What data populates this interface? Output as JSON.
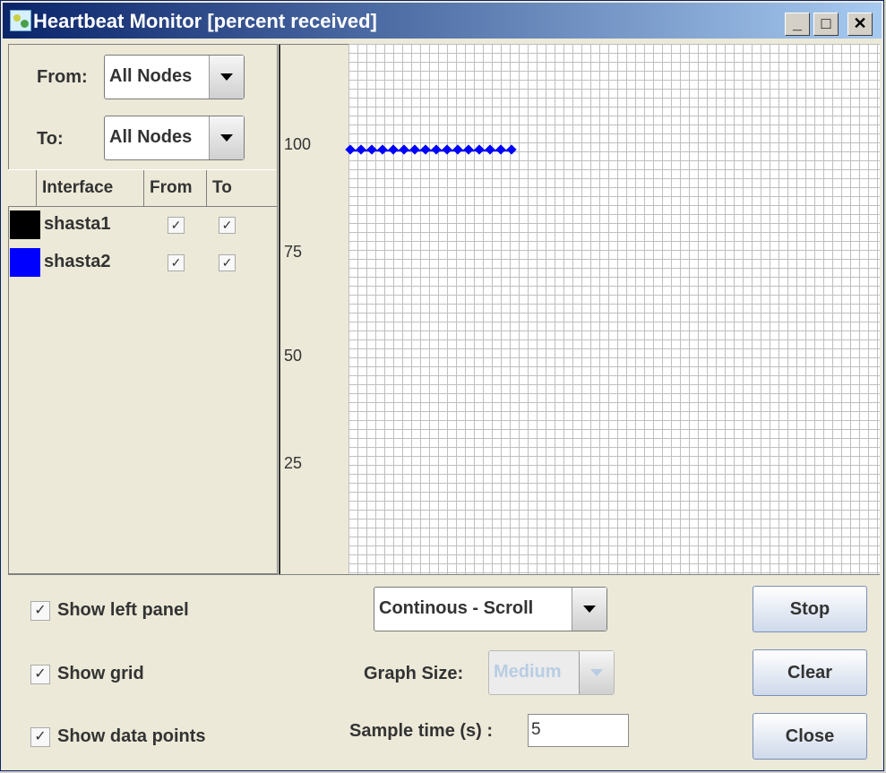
{
  "window": {
    "title": "Heartbeat Monitor [percent received]",
    "min_glyph": "_",
    "max_glyph": "□",
    "close_glyph": "✕"
  },
  "left_panel": {
    "from_label": "From:",
    "from_value": "All Nodes",
    "to_label": "To:",
    "to_value": "All Nodes",
    "table_headers": [
      "",
      "Interface",
      "From",
      "To"
    ],
    "rows": [
      {
        "color": "#000000",
        "name": "shasta1",
        "from": "✓",
        "to": "✓"
      },
      {
        "color": "#0000ff",
        "name": "shasta2",
        "from": "✓",
        "to": "✓"
      }
    ]
  },
  "chart_data": {
    "type": "line",
    "title": "",
    "xlabel": "",
    "ylabel": "",
    "y_ticks": [
      100,
      75,
      50,
      25
    ],
    "grid": true,
    "series": [
      {
        "name": "shasta2",
        "color": "#0000ff",
        "x": [
          1,
          2,
          3,
          4,
          5,
          6,
          7,
          8,
          9,
          10,
          11,
          12,
          13,
          14,
          15,
          16
        ],
        "values": [
          100,
          100,
          100,
          100,
          100,
          100,
          100,
          100,
          100,
          100,
          100,
          100,
          100,
          100,
          100,
          100
        ]
      }
    ]
  },
  "controls": {
    "show_left_panel": "Show left panel",
    "show_grid": "Show grid",
    "show_data_points": "Show data points",
    "check_glyph": "✓",
    "mode_value": "Continous - Scroll",
    "graph_size_label": "Graph Size:",
    "graph_size_value": "Medium",
    "sample_time_label": "Sample time (s) :",
    "sample_time_value": "5",
    "stop_label": "Stop",
    "clear_label": "Clear",
    "close_label": "Close"
  }
}
